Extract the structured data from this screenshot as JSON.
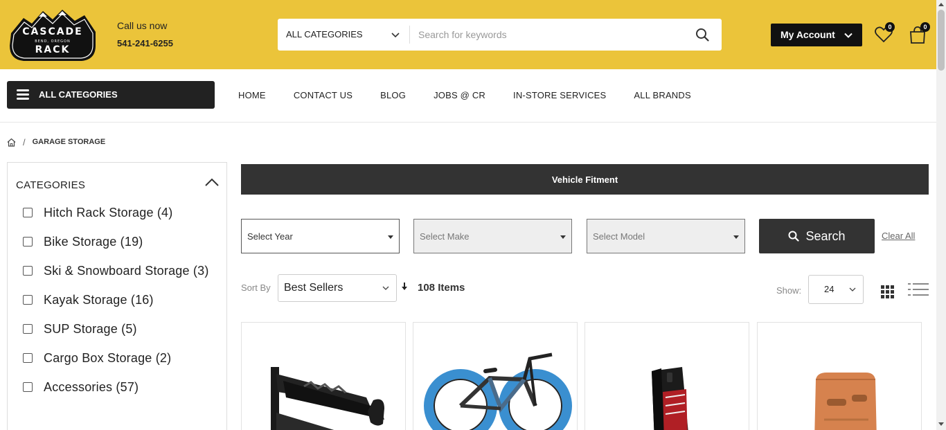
{
  "header": {
    "logo_text_top": "CASCADE",
    "logo_text_sub": "BEND, OREGON",
    "logo_text_bottom": "RACK",
    "call_label": "Call us now",
    "phone": "541-241-6255",
    "category_select": "ALL CATEGORIES",
    "search_placeholder": "Search for keywords",
    "account_label": "My Account",
    "wishlist_count": "0",
    "cart_count": "0",
    "bg_color": "#ebc43a"
  },
  "nav": {
    "all_categories": "ALL CATEGORIES",
    "links": [
      "HOME",
      "CONTACT US",
      "BLOG",
      "JOBS @ CR",
      "IN-STORE SERVICES",
      "ALL BRANDS"
    ]
  },
  "breadcrumb": {
    "current": "GARAGE STORAGE"
  },
  "sidebar": {
    "title": "CATEGORIES",
    "categories": [
      {
        "label": "Hitch Rack Storage (4)"
      },
      {
        "label": "Bike Storage (19)"
      },
      {
        "label": "Ski & Snowboard Storage (3)"
      },
      {
        "label": "Kayak Storage (16)"
      },
      {
        "label": "SUP Storage (5)"
      },
      {
        "label": "Cargo Box Storage (2)"
      },
      {
        "label": "Accessories (57)"
      }
    ]
  },
  "fitment": {
    "title": "Vehicle Fitment",
    "year": "Select Year",
    "make": "Select Make",
    "model": "Select Model",
    "search": "Search",
    "clear": "Clear All"
  },
  "toolbar": {
    "sort_label": "Sort By",
    "sort_value": "Best Sellers",
    "items": "108 Items",
    "show_label": "Show:",
    "show_value": "24"
  },
  "products": [
    {
      "icon": "wall-bike-hook"
    },
    {
      "icon": "fat-tire-bike"
    },
    {
      "icon": "hitch-storage-rack"
    },
    {
      "icon": "orange-storage-mount"
    }
  ]
}
